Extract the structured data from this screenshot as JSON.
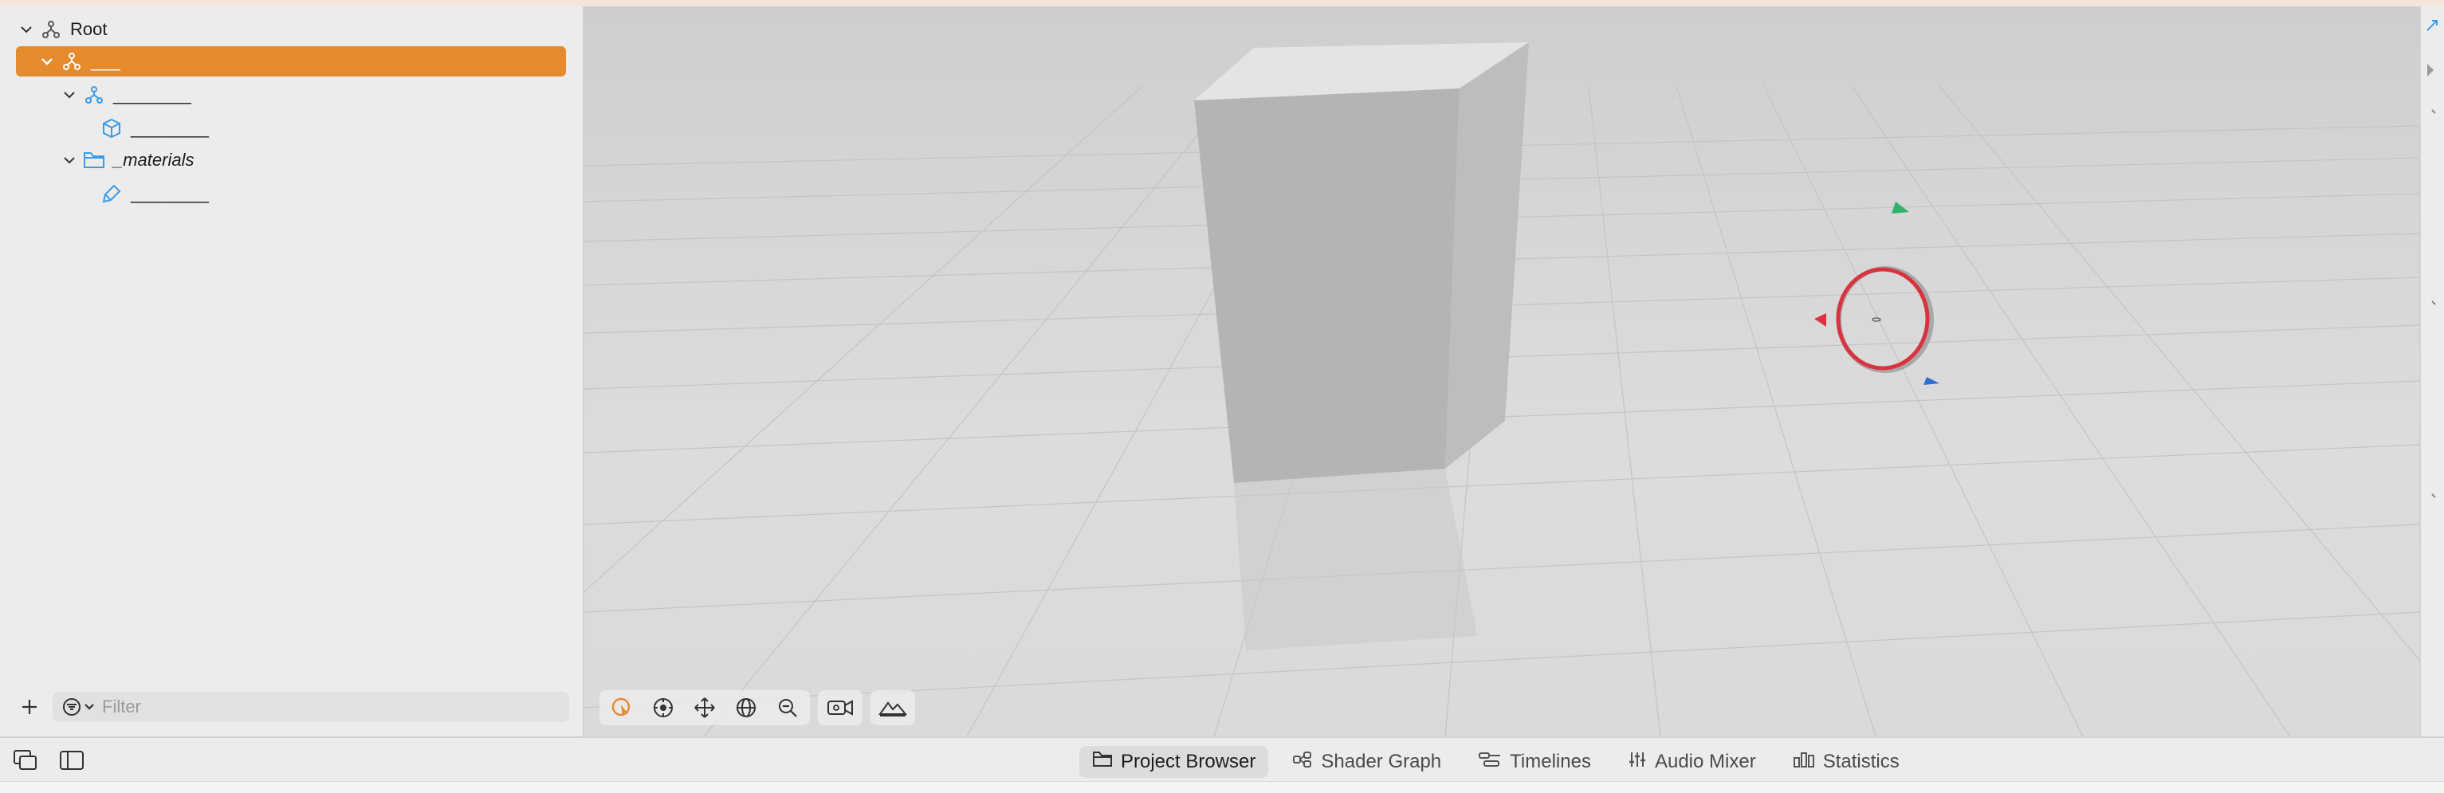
{
  "outline": {
    "items": [
      {
        "label": "Root",
        "icon": "entity-icon",
        "italic": false
      },
      {
        "label": "___",
        "icon": "entity-icon",
        "italic": false
      },
      {
        "label": "________",
        "icon": "entity-icon",
        "italic": false
      },
      {
        "label": "________",
        "icon": "cube-icon",
        "italic": false
      },
      {
        "label": "_materials",
        "icon": "folder-icon",
        "italic": true
      },
      {
        "label": "________",
        "icon": "material-brush-icon",
        "italic": false
      }
    ],
    "selected_index": 1,
    "filter_placeholder": "Filter",
    "add_label": "+"
  },
  "viewport": {
    "tools": [
      "select-tool-icon",
      "orbit-tool-icon",
      "move-tool-icon",
      "rotate-tool-icon",
      "zoom-tool-icon",
      "camera-icon",
      "environment-icon"
    ],
    "active_tool": "select-tool-icon"
  },
  "bottom_tabs": [
    {
      "label": "Project Browser",
      "icon": "folder-icon",
      "active": true
    },
    {
      "label": "Shader Graph",
      "icon": "shader-graph-icon",
      "active": false
    },
    {
      "label": "Timelines",
      "icon": "timelines-icon",
      "active": false
    },
    {
      "label": "Audio Mixer",
      "icon": "audio-mixer-icon",
      "active": false
    },
    {
      "label": "Statistics",
      "icon": "statistics-icon",
      "active": false
    }
  ],
  "colors": {
    "selection": "#e68a2e",
    "accent_blue": "#3b9be8",
    "gizmo_red": "#d9333f",
    "gizmo_green": "#2fb36b",
    "gizmo_blue": "#2f6fd0"
  }
}
